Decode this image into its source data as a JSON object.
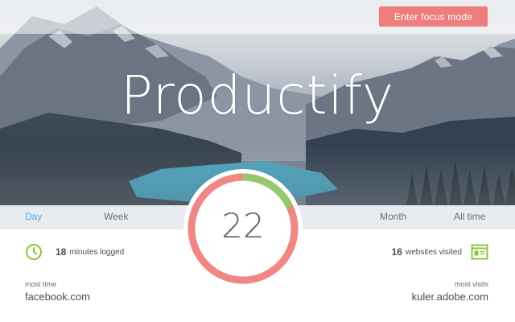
{
  "header": {
    "focus_button_label": "Enter focus mode"
  },
  "app_title": "Productify",
  "tabs": [
    {
      "label": "Day",
      "active": true
    },
    {
      "label": "Week",
      "active": false
    },
    {
      "label": "Month",
      "active": false
    },
    {
      "label": "All time",
      "active": false
    }
  ],
  "ring": {
    "value": "22",
    "green_fraction": 0.18,
    "colors": {
      "productive": "#96c96e",
      "unproductive": "#ef8785"
    }
  },
  "stats": {
    "minutes": {
      "value": "18",
      "label": "minutes logged",
      "icon": "clock-icon"
    },
    "websites": {
      "value": "16",
      "label": "websites visited",
      "icon": "browser-window-icon"
    }
  },
  "most_time": {
    "caption": "most time",
    "site": "facebook.com"
  },
  "most_visits": {
    "caption": "most visits",
    "site": "kuler.adobe.com"
  },
  "colors": {
    "accent_red": "#ef7d7b",
    "accent_blue": "#5fa8e0",
    "accent_green": "#8cc63f"
  }
}
